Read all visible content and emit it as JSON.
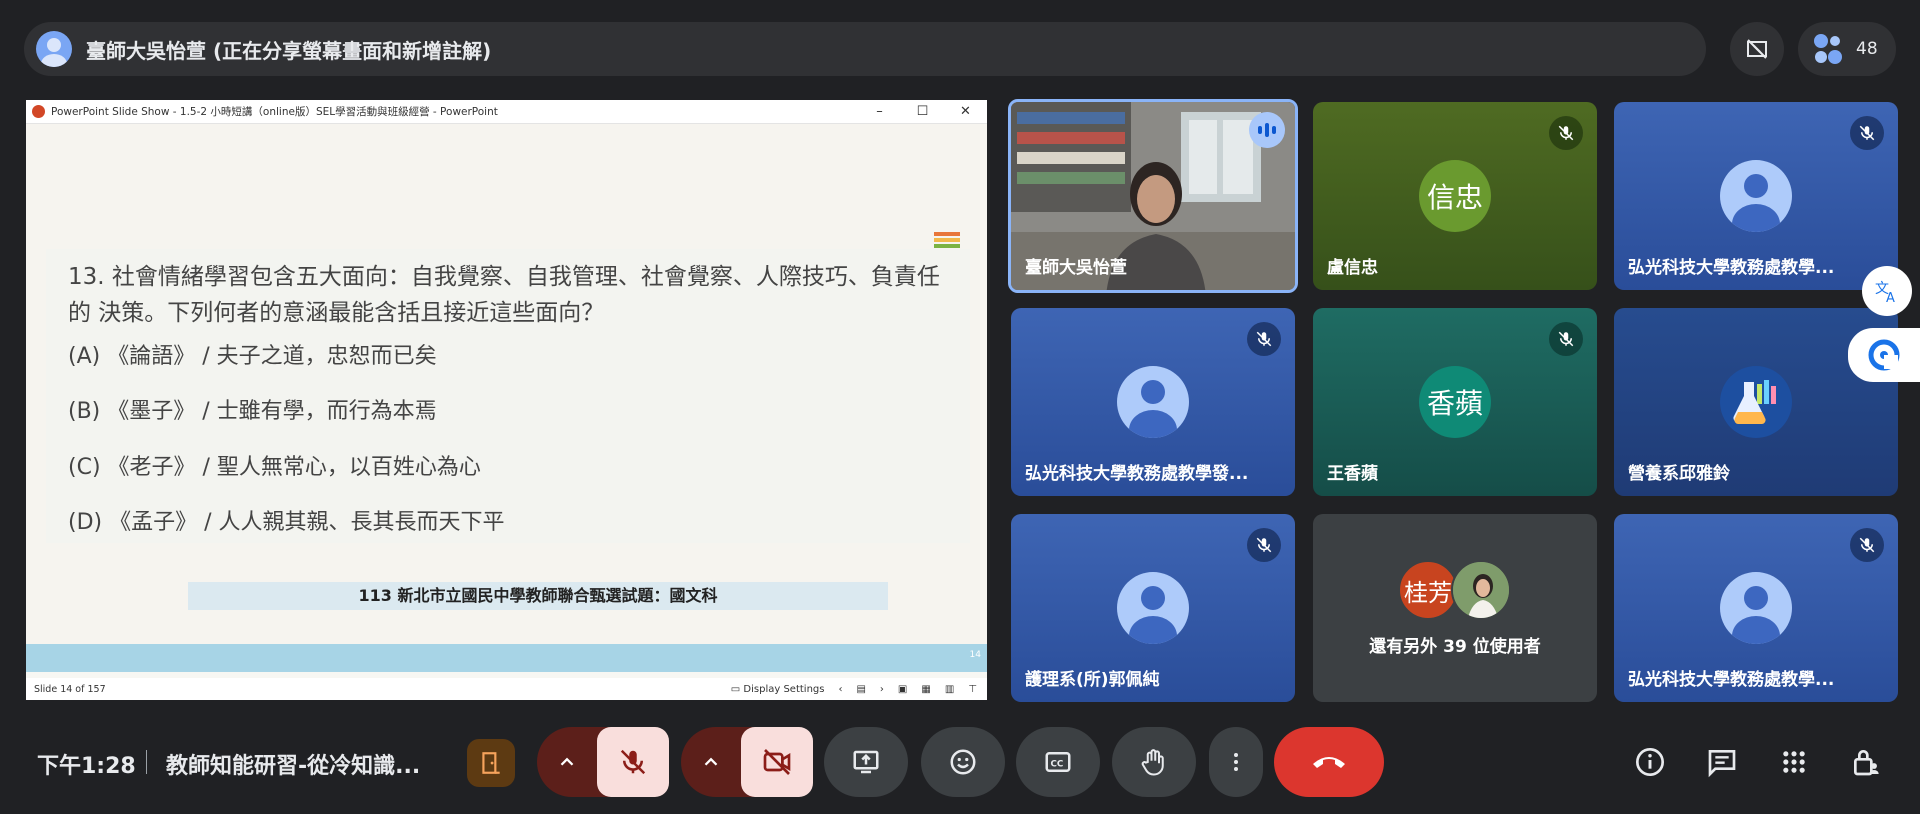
{
  "presenter_bar": {
    "text": "臺師大吳怡萱 (正在分享螢幕畫面和新增註解)"
  },
  "people_count": "48",
  "powerpoint": {
    "window_title": "PowerPoint Slide Show  -  1.5-2 小時短講（online版）SEL學習活動與班級經營 - PowerPoint",
    "question": "13. 社會情緒學習包含五大面向：自我覺察、自我管理、社會覺察、人際技巧、負責任的 決策。下列何者的意涵最能含括且接近這些面向？",
    "options": [
      "(A) 《論語》 / 夫子之道，忠恕而已矣",
      "(B) 《墨子》 / 士雖有學，而行為本焉",
      "(C) 《老子》 / 聖人無常心，以百姓心為心",
      "(D) 《孟子》 / 人人親其親、長其長而天下平"
    ],
    "banner": "113 新北市立國民中學教師聯合甄選試題：國文科",
    "slide_number": "14",
    "status_left": "Slide 14 of 157",
    "display_settings": "Display Settings",
    "flag_colors": [
      "#e8763a",
      "#f2b84b",
      "#7cb342"
    ]
  },
  "tiles": [
    {
      "name": "臺師大吳怡萱",
      "speaking": true
    },
    {
      "name": "盧信忠",
      "initials": "信忠",
      "avatar_color": "#6a9a2f"
    },
    {
      "name": "弘光科技大學教務處教學..."
    },
    {
      "name": "弘光科技大學教務處教學發..."
    },
    {
      "name": "王香蘋",
      "initials": "香蘋",
      "avatar_color": "#0f8a76"
    },
    {
      "name": "營養系邱雅鈴"
    },
    {
      "name": "護理系(所)郭佩純"
    },
    {
      "others_text": "還有另外 39 位使用者",
      "initials": "桂芳",
      "avatar_color": "#c8441f"
    },
    {
      "name": "弘光科技大學教務處教學..."
    }
  ],
  "bottom": {
    "clock": "下午1:28",
    "meeting_title": "教師知能研習-從冷知識..."
  },
  "colors": {
    "end_call": "#dc362e",
    "muted_bg": "#f9dedc",
    "accent_blue": "#8ab4f8"
  }
}
